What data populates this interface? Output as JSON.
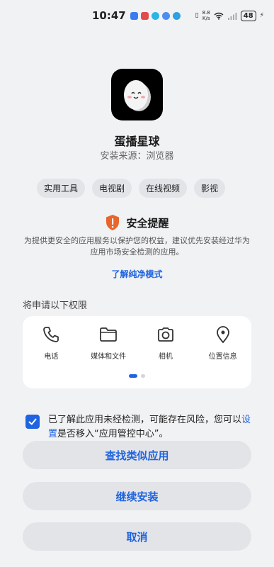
{
  "status": {
    "time": "10:47",
    "net_speed_value": "8.8",
    "net_speed_unit": "K/s",
    "battery": "48"
  },
  "app": {
    "name": "蛋播星球",
    "source": "安装来源：浏览器",
    "tags": [
      "实用工具",
      "电视剧",
      "在线视频",
      "影视"
    ]
  },
  "security": {
    "title": "安全提醒",
    "description": "为提供更安全的应用服务以保护您的权益，建议优先安装经过华为应用市场安全检测的应用。",
    "link": "了解纯净模式"
  },
  "permissions": {
    "heading": "将申请以下权限",
    "items": [
      {
        "label": "电话",
        "icon": "phone-icon"
      },
      {
        "label": "媒体和文件",
        "icon": "folder-icon"
      },
      {
        "label": "相机",
        "icon": "camera-icon"
      },
      {
        "label": "位置信息",
        "icon": "location-icon"
      }
    ],
    "page": 1,
    "page_count": 2
  },
  "agreement": {
    "checked": true,
    "text_before": "已了解此应用未经检测，可能存在风险，您可以",
    "link": "设置",
    "text_after": "是否移入“应用管控中心”。"
  },
  "buttons": {
    "similar": "查找类似应用",
    "continue": "继续安装",
    "cancel": "取消"
  },
  "colors": {
    "accent": "#1f64e0",
    "warning": "#e8652b",
    "background": "#f1f2f4"
  }
}
